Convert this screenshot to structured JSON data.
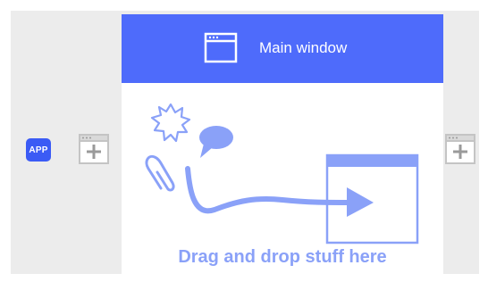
{
  "app": {
    "badge_label": "APP"
  },
  "main_window": {
    "title": "Main window",
    "drop_hint": "Drag and drop stuff here"
  },
  "icons": {
    "app": "app-icon",
    "add_window": "add-window-icon",
    "window": "window-icon",
    "sparkle": "sparkle-icon",
    "speech_bubble": "speech-bubble-icon",
    "paperclip": "paperclip-icon",
    "arrow": "curved-arrow-icon",
    "target_window": "target-window-icon"
  },
  "colors": {
    "accent": "#4e6bfb",
    "app_badge": "#3b5bf5",
    "illustration": "#8aa1f8",
    "background": "#ececec"
  }
}
